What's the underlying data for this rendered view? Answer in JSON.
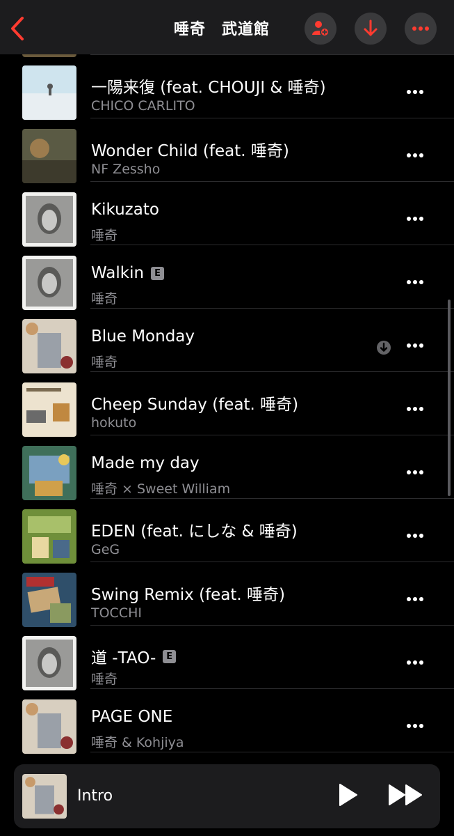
{
  "header": {
    "title": "唾奇　武道館",
    "back_icon": "chevron-left-icon",
    "accent": "#ff3b30"
  },
  "tracks": [
    {
      "title": "一陽来復 (feat. CHOUJI & 唾奇)",
      "artist": "CHICO CARLITO",
      "explicit": false
    },
    {
      "title": "Wonder Child (feat. 唾奇)",
      "artist": "NF Zessho",
      "explicit": false
    },
    {
      "title": "Kikuzato",
      "artist": "唾奇",
      "explicit": false
    },
    {
      "title": "Walkin",
      "artist": "唾奇",
      "explicit": true,
      "badge": "E"
    },
    {
      "title": "Blue Monday",
      "artist": "唾奇",
      "explicit": false,
      "downloadable": true
    },
    {
      "title": "Cheep Sunday (feat. 唾奇)",
      "artist": "hokuto",
      "explicit": false
    },
    {
      "title": "Made my day",
      "artist": "唾奇 × Sweet William",
      "explicit": false
    },
    {
      "title": "EDEN (feat. にしな & 唾奇)",
      "artist": "GeG",
      "explicit": false
    },
    {
      "title": "Swing Remix (feat. 唾奇)",
      "artist": "TOCCHI",
      "explicit": false
    },
    {
      "title": "道 -TAO-",
      "artist": "唾奇",
      "explicit": true,
      "badge": "E"
    },
    {
      "title": "PAGE ONE",
      "artist": "唾奇 & Kohjiya",
      "explicit": false
    }
  ],
  "player": {
    "now_playing": "Intro"
  }
}
